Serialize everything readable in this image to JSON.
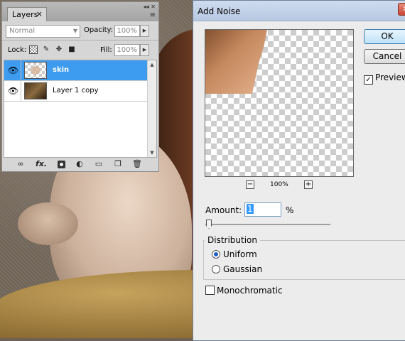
{
  "layers_panel": {
    "tab_label": "Layers",
    "tab_close": "×",
    "panel_controls": "◂◂ ✕",
    "menu_icon": "≡",
    "blend_mode": "Normal",
    "opacity_label": "Opacity:",
    "opacity_value": "100%",
    "lock_label": "Lock:",
    "fill_label": "Fill:",
    "fill_value": "100%",
    "layers": [
      {
        "name": "skin",
        "selected": true,
        "visible": true
      },
      {
        "name": "Layer 1 copy",
        "selected": false,
        "visible": true
      }
    ],
    "footer_icons": [
      "link-icon",
      "fx-icon",
      "mask-icon",
      "adjustment-icon",
      "group-folder-icon",
      "new-layer-icon",
      "trash-icon"
    ],
    "fx_label": "fx."
  },
  "dialog": {
    "title": "Add Noise",
    "ok_label": "OK",
    "cancel_label": "Cancel",
    "preview_label": "Preview",
    "preview_checked": true,
    "zoom_value": "100%",
    "zoom_out": "−",
    "zoom_in": "+",
    "amount_label": "Amount:",
    "amount_value": "1",
    "amount_unit": "%",
    "distribution_title": "Distribution",
    "distribution_options": [
      {
        "label": "Uniform",
        "selected": true
      },
      {
        "label": "Gaussian",
        "selected": false
      }
    ],
    "monochromatic_label": "Monochromatic",
    "monochromatic_checked": false
  }
}
